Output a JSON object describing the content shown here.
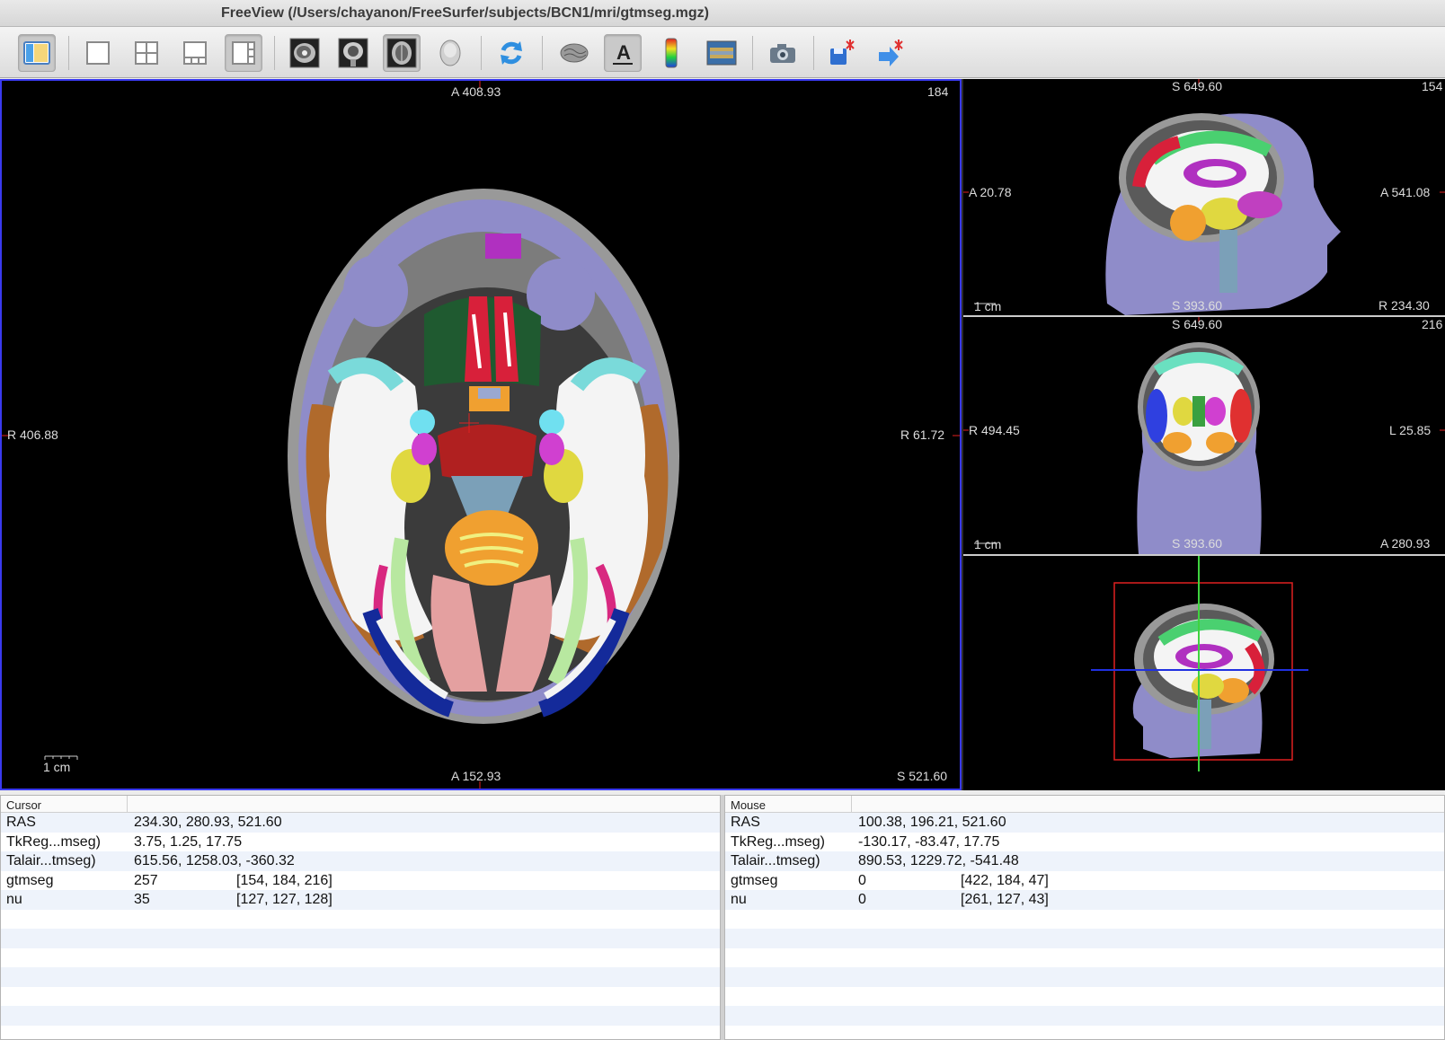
{
  "window": {
    "title": "FreeView (/Users/chayanon/FreeSurfer/subjects/BCN1/mri/gtmseg.mgz)"
  },
  "toolbar": {
    "buttons": [
      {
        "name": "toggle-panel",
        "icon": "panel-layout-icon",
        "active": true
      },
      {
        "name": "layout-1x1",
        "icon": "layout-1x1-icon"
      },
      {
        "name": "layout-2x2",
        "icon": "layout-2x2-icon"
      },
      {
        "name": "layout-1-3",
        "icon": "layout-1-3-icon"
      },
      {
        "name": "layout-1-3-vertical",
        "icon": "layout-1-3-vertical-icon",
        "active": true
      },
      {
        "name": "view-sagittal",
        "icon": "sagittal-brain-icon"
      },
      {
        "name": "view-coronal",
        "icon": "coronal-brain-icon"
      },
      {
        "name": "view-axial",
        "icon": "axial-brain-icon",
        "active": true
      },
      {
        "name": "view-3d",
        "icon": "3d-head-icon"
      },
      {
        "name": "reset-view",
        "icon": "refresh-icon"
      },
      {
        "name": "navigate-surface",
        "icon": "surface-icon"
      },
      {
        "name": "annotation",
        "icon": "text-annotation-icon",
        "active": true
      },
      {
        "name": "colorbar",
        "icon": "colorbar-icon"
      },
      {
        "name": "show-volume",
        "icon": "image-icon"
      },
      {
        "name": "snapshot",
        "icon": "camera-icon"
      },
      {
        "name": "save-point",
        "icon": "save-point-icon"
      },
      {
        "name": "goto-point",
        "icon": "goto-point-icon"
      }
    ]
  },
  "main_view": {
    "top": "A 408.93",
    "bottom": "A 152.93",
    "left": "R 406.88",
    "right": "R 61.72",
    "top_right": "184",
    "bottom_right": "S 521.60",
    "scale": "1 cm"
  },
  "sagittal_view": {
    "top": "S 649.60",
    "bottom": "S 393.60",
    "left": "A 20.78",
    "right": "A 541.08",
    "top_right": "154",
    "bottom_right": "R 234.30",
    "scale": "1 cm"
  },
  "coronal_view": {
    "top": "S 649.60",
    "bottom": "S 393.60",
    "left": "R 494.45",
    "right": "L 25.85",
    "top_right": "216",
    "bottom_right": "A 280.93",
    "scale": "1 cm"
  },
  "cursor_panel": {
    "header": "Cursor",
    "rows": [
      {
        "key": "RAS",
        "value": "234.30, 280.93, 521.60",
        "extra": ""
      },
      {
        "key": "TkReg...mseg)",
        "value": "3.75, 1.25, 17.75",
        "extra": ""
      },
      {
        "key": "Talair...tmseg)",
        "value": "615.56, 1258.03, -360.32",
        "extra": ""
      },
      {
        "key": "gtmseg",
        "value": "257",
        "extra": "[154, 184, 216]"
      },
      {
        "key": "nu",
        "value": "35",
        "extra": "[127, 127, 128]"
      }
    ]
  },
  "mouse_panel": {
    "header": "Mouse",
    "rows": [
      {
        "key": "RAS",
        "value": "100.38, 196.21, 521.60",
        "extra": ""
      },
      {
        "key": "TkReg...mseg)",
        "value": "-130.17, -83.47, 17.75",
        "extra": ""
      },
      {
        "key": "Talair...tmseg)",
        "value": "890.53, 1229.72, -541.48",
        "extra": ""
      },
      {
        "key": "gtmseg",
        "value": "0",
        "extra": "[422, 184, 47]"
      },
      {
        "key": "nu",
        "value": "0",
        "extra": "[261, 127, 43]"
      }
    ]
  },
  "colors": {
    "active_view_border": "#3a3af0",
    "head_tissue": "#8f8cc9",
    "crosshair_red": "#e02020",
    "crosshair_green": "#3fd33f",
    "crosshair_blue": "#2030e0"
  }
}
